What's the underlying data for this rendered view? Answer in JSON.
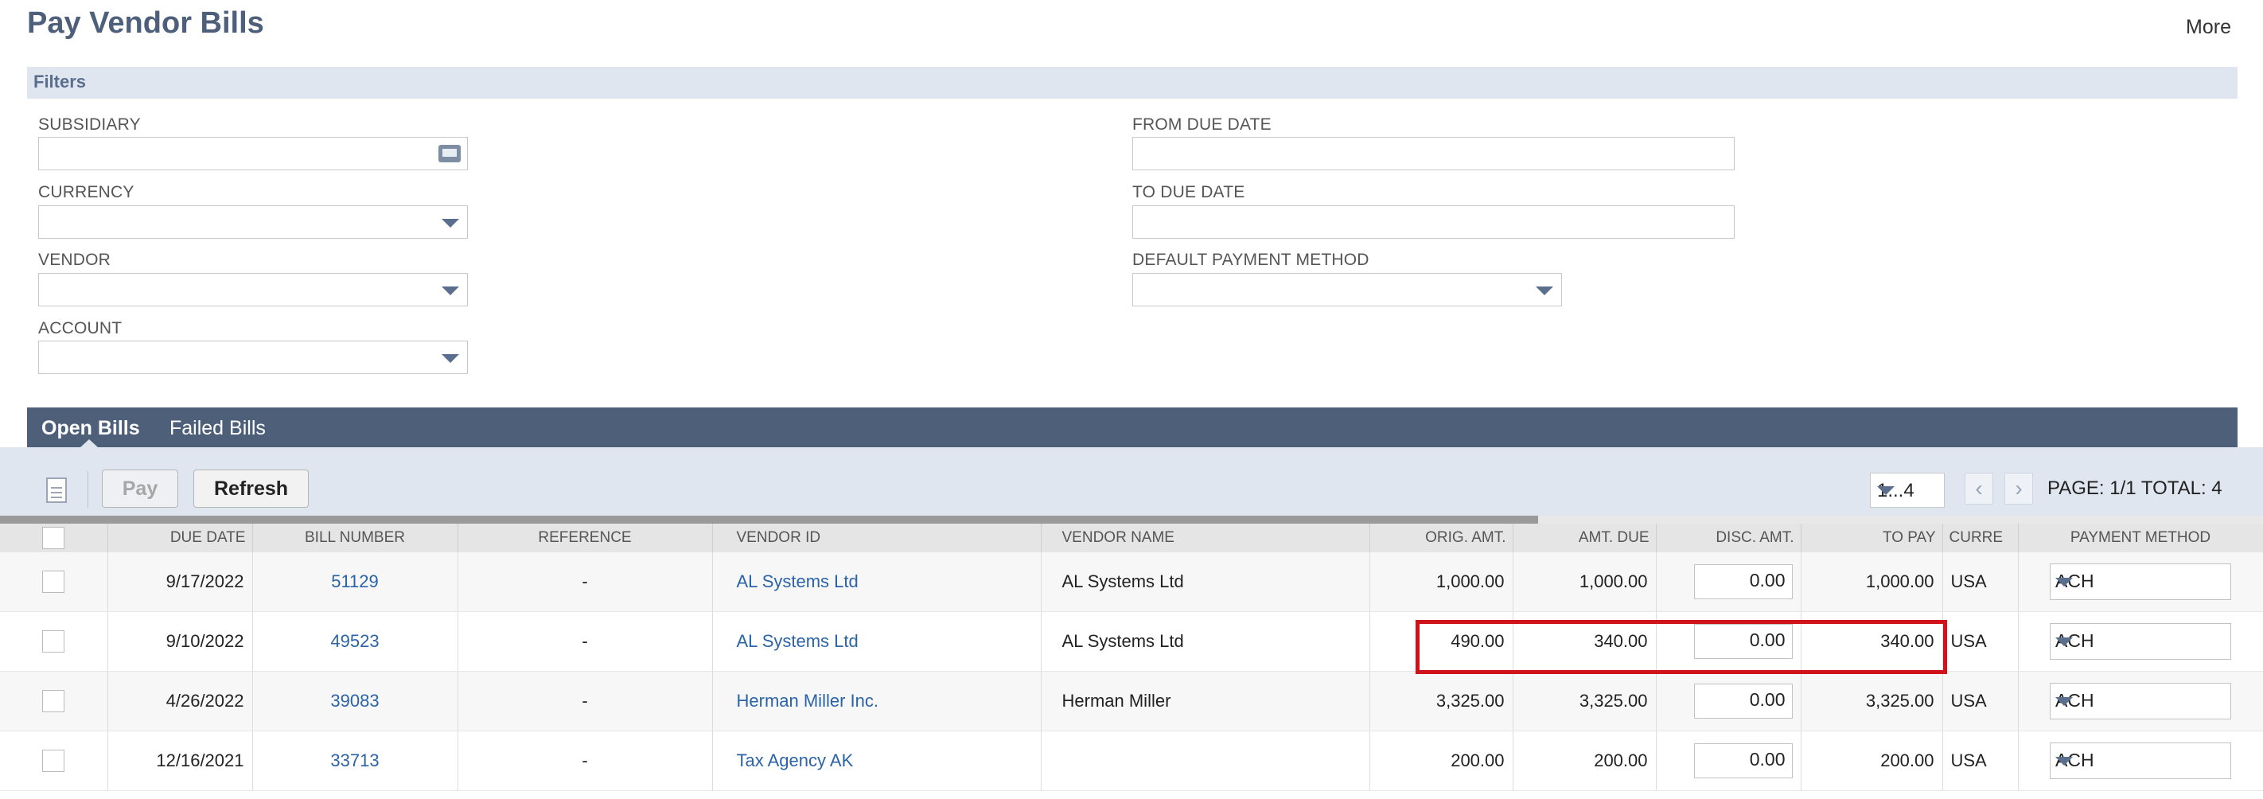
{
  "page": {
    "title": "Pay Vendor Bills",
    "more_label": "More"
  },
  "filters": {
    "header": "Filters",
    "subsidiary": {
      "label": "SUBSIDIARY",
      "value": ""
    },
    "currency": {
      "label": "CURRENCY",
      "value": ""
    },
    "vendor": {
      "label": "VENDOR",
      "value": ""
    },
    "account": {
      "label": "ACCOUNT",
      "value": ""
    },
    "from_due_date": {
      "label": "FROM DUE DATE",
      "value": ""
    },
    "to_due_date": {
      "label": "TO DUE DATE",
      "value": ""
    },
    "default_payment_method": {
      "label": "DEFAULT PAYMENT METHOD",
      "value": ""
    }
  },
  "tabs": [
    {
      "label": "Open Bills",
      "active": true
    },
    {
      "label": "Failed Bills",
      "active": false
    }
  ],
  "toolbar": {
    "pay_label": "Pay",
    "refresh_label": "Refresh",
    "pager_value": "1...4",
    "prev_icon": "chevron-left-icon",
    "next_icon": "chevron-right-icon",
    "page_total": "PAGE: 1/1  TOTAL: 4"
  },
  "table": {
    "columns": [
      "DUE DATE",
      "BILL NUMBER",
      "REFERENCE",
      "VENDOR ID",
      "VENDOR NAME",
      "ORIG. AMT.",
      "AMT. DUE",
      "DISC. AMT.",
      "TO PAY",
      "CURRE",
      "PAYMENT METHOD"
    ],
    "rows": [
      {
        "due_date": "9/17/2022",
        "bill_number": "51129",
        "reference": "-",
        "vendor_id": "AL Systems Ltd",
        "vendor_name": "AL Systems Ltd",
        "orig_amt": "1,000.00",
        "amt_due": "1,000.00",
        "disc_amt": "0.00",
        "to_pay": "1,000.00",
        "currency": "USA",
        "payment_method": "ACH"
      },
      {
        "due_date": "9/10/2022",
        "bill_number": "49523",
        "reference": "-",
        "vendor_id": "AL Systems Ltd",
        "vendor_name": "AL Systems Ltd",
        "orig_amt": "490.00",
        "amt_due": "340.00",
        "disc_amt": "0.00",
        "to_pay": "340.00",
        "currency": "USA",
        "payment_method": "ACH"
      },
      {
        "due_date": "4/26/2022",
        "bill_number": "39083",
        "reference": "-",
        "vendor_id": "Herman Miller Inc.",
        "vendor_name": "Herman Miller",
        "orig_amt": "3,325.00",
        "amt_due": "3,325.00",
        "disc_amt": "0.00",
        "to_pay": "3,325.00",
        "currency": "USA",
        "payment_method": "ACH"
      },
      {
        "due_date": "12/16/2021",
        "bill_number": "33713",
        "reference": "-",
        "vendor_id": "Tax Agency AK",
        "vendor_name": "",
        "orig_amt": "200.00",
        "amt_due": "200.00",
        "disc_amt": "0.00",
        "to_pay": "200.00",
        "currency": "USA",
        "payment_method": "ACH"
      }
    ]
  },
  "colors": {
    "accent": "#4e5f7a",
    "link": "#2b63a8",
    "highlight": "#d0131b"
  }
}
